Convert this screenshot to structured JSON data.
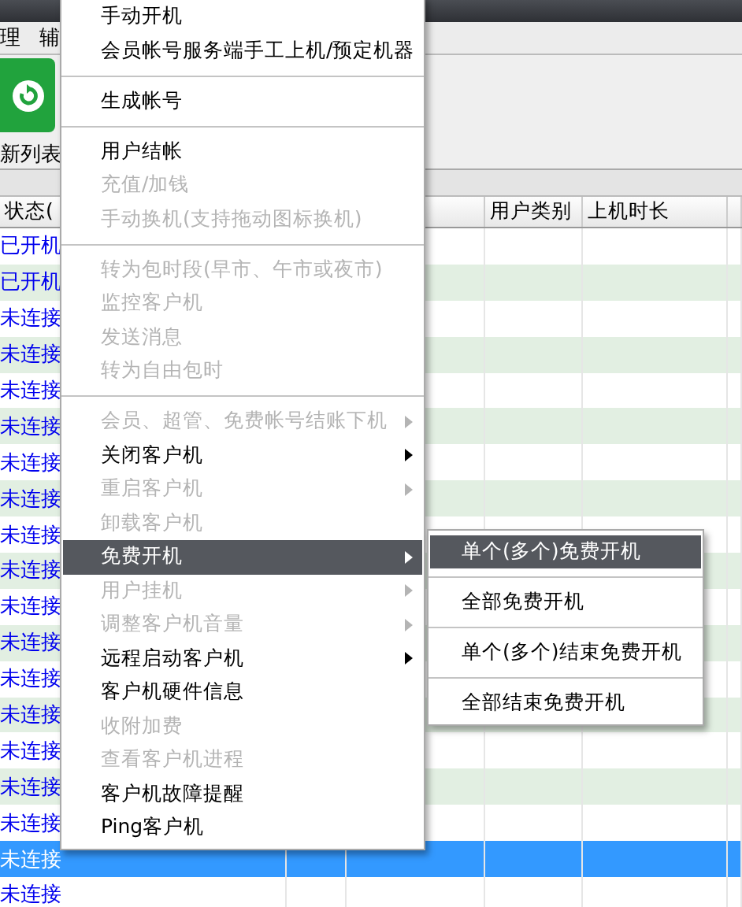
{
  "menubar": [
    "理",
    "辅"
  ],
  "toolbar": {
    "refresh_label": "新列表"
  },
  "table": {
    "columns": [
      {
        "label": "状态("
      },
      {},
      {},
      {
        "label": "用户类别"
      },
      {
        "label": "上机时长"
      },
      {}
    ],
    "rows": [
      {
        "status": "已开机",
        "selected": false
      },
      {
        "status": "已开机",
        "selected": false
      },
      {
        "status": "未连接",
        "selected": false
      },
      {
        "status": "未连接",
        "selected": false
      },
      {
        "status": "未连接",
        "selected": false
      },
      {
        "status": "未连接",
        "selected": false
      },
      {
        "status": "未连接",
        "selected": false
      },
      {
        "status": "未连接",
        "selected": false
      },
      {
        "status": "未连接",
        "selected": false
      },
      {
        "status": "未连接",
        "selected": false
      },
      {
        "status": "未连接",
        "selected": false
      },
      {
        "status": "未连接",
        "selected": false
      },
      {
        "status": "未连接",
        "selected": false
      },
      {
        "status": "未连接",
        "selected": false
      },
      {
        "status": "未连接",
        "selected": false
      },
      {
        "status": "未连接",
        "selected": false
      },
      {
        "status": "未连接",
        "selected": false
      },
      {
        "status": "未连接",
        "selected": true
      },
      {
        "status": "未连接",
        "selected": false
      }
    ]
  },
  "context_menu": {
    "items": [
      {
        "kind": "item",
        "label": "手动开机",
        "disabled": false,
        "submenu": false,
        "selected": false
      },
      {
        "kind": "item",
        "label": "会员帐号服务端手工上机/预定机器",
        "disabled": false,
        "submenu": false,
        "selected": false
      },
      {
        "kind": "separator"
      },
      {
        "kind": "item",
        "label": "生成帐号",
        "disabled": false,
        "submenu": false,
        "selected": false
      },
      {
        "kind": "separator"
      },
      {
        "kind": "item",
        "label": "用户结帐",
        "disabled": false,
        "submenu": false,
        "selected": false
      },
      {
        "kind": "item",
        "label": "充值/加钱",
        "disabled": true,
        "submenu": false,
        "selected": false
      },
      {
        "kind": "item",
        "label": "手动换机(支持拖动图标换机)",
        "disabled": true,
        "submenu": false,
        "selected": false
      },
      {
        "kind": "separator"
      },
      {
        "kind": "item",
        "label": "转为包时段(早市、午市或夜市)",
        "disabled": true,
        "submenu": false,
        "selected": false
      },
      {
        "kind": "item",
        "label": "监控客户机",
        "disabled": true,
        "submenu": false,
        "selected": false
      },
      {
        "kind": "item",
        "label": "发送消息",
        "disabled": true,
        "submenu": false,
        "selected": false
      },
      {
        "kind": "item",
        "label": "转为自由包时",
        "disabled": true,
        "submenu": false,
        "selected": false
      },
      {
        "kind": "separator"
      },
      {
        "kind": "item",
        "label": "会员、超管、免费帐号结账下机",
        "disabled": true,
        "submenu": true,
        "selected": false
      },
      {
        "kind": "item",
        "label": "关闭客户机",
        "disabled": false,
        "submenu": true,
        "selected": false
      },
      {
        "kind": "item",
        "label": "重启客户机",
        "disabled": true,
        "submenu": true,
        "selected": false
      },
      {
        "kind": "item",
        "label": "卸载客户机",
        "disabled": true,
        "submenu": false,
        "selected": false
      },
      {
        "kind": "item",
        "label": "免费开机",
        "disabled": false,
        "submenu": true,
        "selected": true
      },
      {
        "kind": "item",
        "label": "用户挂机",
        "disabled": true,
        "submenu": true,
        "selected": false
      },
      {
        "kind": "item",
        "label": "调整客户机音量",
        "disabled": true,
        "submenu": true,
        "selected": false
      },
      {
        "kind": "item",
        "label": "远程启动客户机",
        "disabled": false,
        "submenu": true,
        "selected": false
      },
      {
        "kind": "item",
        "label": "客户机硬件信息",
        "disabled": false,
        "submenu": false,
        "selected": false
      },
      {
        "kind": "item",
        "label": "收附加费",
        "disabled": true,
        "submenu": false,
        "selected": false
      },
      {
        "kind": "item",
        "label": "查看客户机进程",
        "disabled": true,
        "submenu": false,
        "selected": false
      },
      {
        "kind": "item",
        "label": "客户机故障提醒",
        "disabled": false,
        "submenu": false,
        "selected": false
      },
      {
        "kind": "item",
        "label": "Ping客户机",
        "disabled": false,
        "submenu": false,
        "selected": false
      }
    ]
  },
  "submenu": {
    "items": [
      {
        "kind": "item",
        "label": "单个(多个)免费开机",
        "disabled": false,
        "submenu": false,
        "selected": true
      },
      {
        "kind": "separator"
      },
      {
        "kind": "item",
        "label": "全部免费开机",
        "disabled": false,
        "submenu": false,
        "selected": false
      },
      {
        "kind": "separator"
      },
      {
        "kind": "item",
        "label": "单个(多个)结束免费开机",
        "disabled": false,
        "submenu": false,
        "selected": false
      },
      {
        "kind": "separator"
      },
      {
        "kind": "item",
        "label": "全部结束免费开机",
        "disabled": false,
        "submenu": false,
        "selected": false
      }
    ]
  }
}
